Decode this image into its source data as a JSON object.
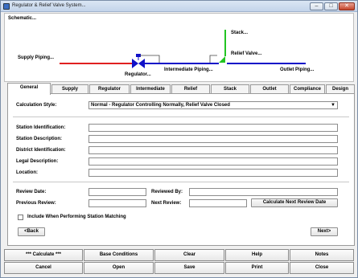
{
  "window": {
    "title": "Regulator & Relief Valve System..."
  },
  "schematic": {
    "title": "Schematic...",
    "labels": {
      "stack": "Stack...",
      "supply_piping": "Supply Piping...",
      "relief_valve": "Relief Valve...",
      "intermediate_piping": "Intermediate Piping...",
      "regulator": "Regulator...",
      "outlet_piping": "Outlet Piping..."
    },
    "colors": {
      "supply": "#e02020",
      "intermediate": "#1010c8",
      "outlet": "#1010c8",
      "stack": "#22c422",
      "relief_valve": "#22c422",
      "regulator": "#1010c8"
    }
  },
  "tabs": [
    {
      "label": "General"
    },
    {
      "label": "Supply"
    },
    {
      "label": "Regulator"
    },
    {
      "label": "Intermediate"
    },
    {
      "label": "Relief"
    },
    {
      "label": "Stack"
    },
    {
      "label": "Outlet"
    },
    {
      "label": "Compliance"
    },
    {
      "label": "Design"
    }
  ],
  "general": {
    "calc_style_label": "Calculation Style:",
    "calc_style_value": "Normal - Regulator Controlling Normally, Relief Valve Closed",
    "station_id_label": "Station Identification:",
    "station_id_value": "",
    "station_desc_label": "Station Description:",
    "station_desc_value": "",
    "district_id_label": "District Identification:",
    "district_id_value": "",
    "legal_desc_label": "Legal Description:",
    "legal_desc_value": "",
    "location_label": "Location:",
    "location_value": "",
    "review_date_label": "Review Date:",
    "review_date_value": "",
    "reviewed_by_label": "Reviewed By:",
    "reviewed_by_value": "",
    "previous_review_label": "Previous Review:",
    "previous_review_value": "",
    "next_review_label": "Next Review:",
    "next_review_value": "",
    "calc_next_review_button": "Calculate Next Review Date",
    "include_matching_label": "Include When Performing Station Matching",
    "include_matching_checked": false,
    "back_button": "<Back",
    "next_button": "Next>"
  },
  "bottom": {
    "calculate": "*** Calculate ***",
    "base_conditions": "Base Conditions",
    "clear": "Clear",
    "help": "Help",
    "notes": "Notes",
    "cancel": "Cancel",
    "open": "Open",
    "save": "Save",
    "print": "Print",
    "close": "Close"
  }
}
